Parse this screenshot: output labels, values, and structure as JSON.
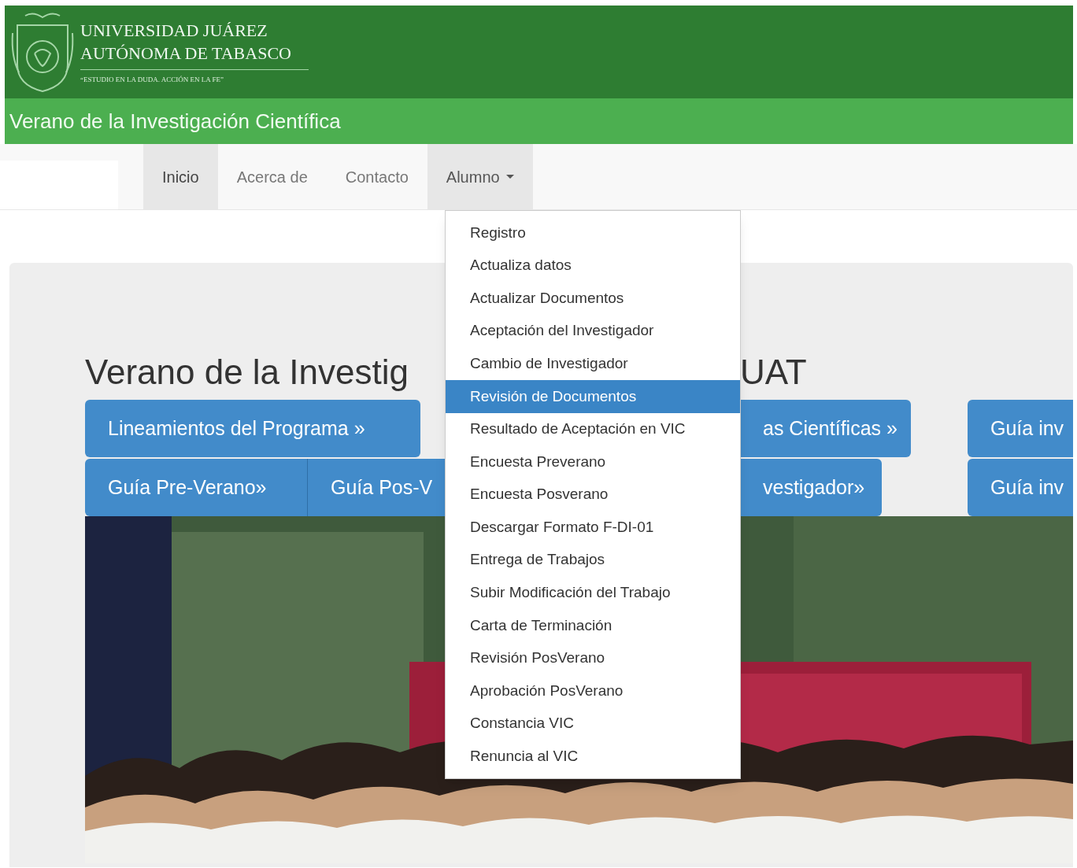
{
  "header": {
    "name_lines": [
      "UNIVERSIDAD JUÁREZ",
      "AUTÓNOMA DE TABASCO"
    ],
    "motto": "“ESTUDIO EN LA DUDA. ACCIÓN EN LA FE”"
  },
  "site_title": "Verano de la Investigación Científica",
  "nav": {
    "items": [
      {
        "label": "Inicio",
        "kind": "link",
        "selected": true
      },
      {
        "label": "Acerca de",
        "kind": "link",
        "selected": false
      },
      {
        "label": "Contacto",
        "kind": "link",
        "selected": false
      },
      {
        "label": "Alumno",
        "kind": "dropdown",
        "selected": false,
        "expanded": true
      }
    ]
  },
  "dropdown_menu": {
    "items": [
      {
        "label": "Registro",
        "selected": false
      },
      {
        "label": "Actualiza datos",
        "selected": false
      },
      {
        "label": "Actualizar Documentos",
        "selected": false
      },
      {
        "label": "Aceptación del Investigador",
        "selected": false
      },
      {
        "label": "Cambio de Investigador",
        "selected": false
      },
      {
        "label": "Revisión de Documentos",
        "selected": true
      },
      {
        "label": "Resultado de Aceptación en VIC",
        "selected": false
      },
      {
        "label": "Encuesta Preverano",
        "selected": false
      },
      {
        "label": "Encuesta Posverano",
        "selected": false
      },
      {
        "label": "Descargar Formato F-DI-01",
        "selected": false
      },
      {
        "label": "Entrega de Trabajos",
        "selected": false
      },
      {
        "label": "Subir Modificación del Trabajo",
        "selected": false
      },
      {
        "label": "Carta de Terminación",
        "selected": false
      },
      {
        "label": "Revisión PosVerano",
        "selected": false
      },
      {
        "label": "Aprobación PosVerano",
        "selected": false
      },
      {
        "label": "Constancia VIC",
        "selected": false
      },
      {
        "label": "Renuncia al VIC",
        "selected": false
      }
    ]
  },
  "jumbotron": {
    "heading_parts": [
      "Verano de la Investig",
      "UAT"
    ],
    "button_rows": [
      [
        "Lineamientos del Programa »",
        "as Científicas »",
        "Guía inv"
      ],
      [
        "Guía Pre-Verano»",
        "Guía Pos-V",
        "vestigador»",
        "Guía inv"
      ]
    ],
    "photo": {
      "kind": "picture"
    }
  }
}
